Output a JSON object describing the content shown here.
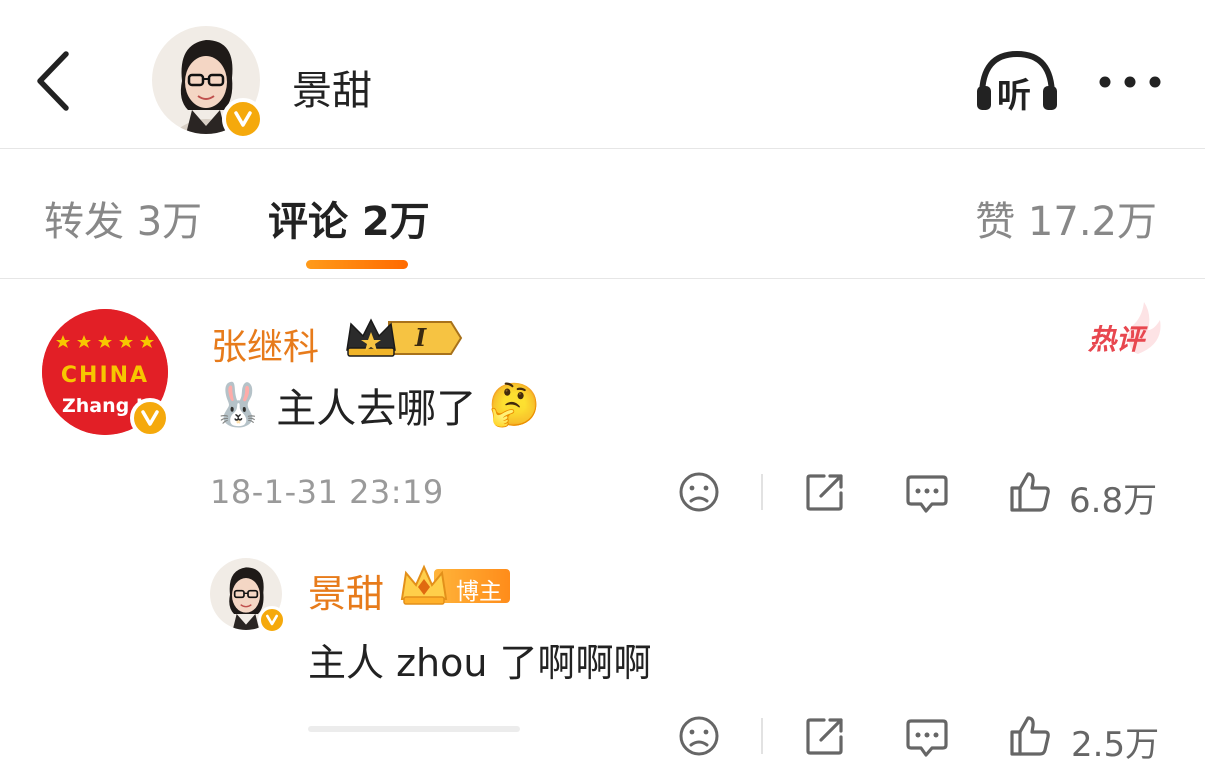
{
  "header": {
    "title": "景甜",
    "listen_label": "听",
    "icons": {
      "back": "chevron-left-icon",
      "listen": "headphones-icon",
      "more": "more-dots-icon"
    },
    "verified_color": "#f5a90c"
  },
  "tabs": {
    "repost": "转发 3万",
    "comment": "评论 2万",
    "like": "赞 17.2万",
    "active": "comment",
    "accent": "#ff7a00"
  },
  "comments": [
    {
      "username": "张继科",
      "level_badge": "I",
      "hot_label": "热评",
      "avatar_text": {
        "top": "CHINA",
        "bottom": "Zhang J"
      },
      "text": "主人去哪了",
      "emoji_before": "🐰",
      "emoji_after": "🤔",
      "time": "18-1-31 23:19",
      "like_count": "6.8万",
      "username_color": "#e77b1b"
    },
    {
      "username": "景甜",
      "role_badge": "博主",
      "text": "主人 zhou 了啊啊啊",
      "like_count": "2.5万"
    }
  ]
}
